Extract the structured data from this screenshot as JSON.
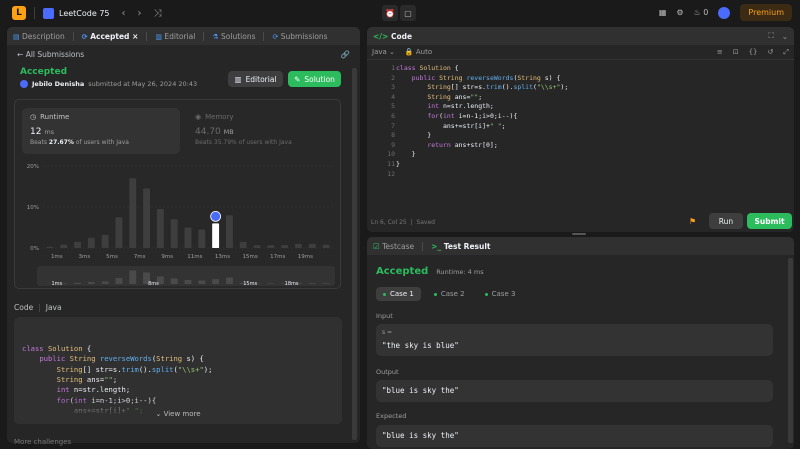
{
  "topbar": {
    "logo": "L",
    "problem_list": "LeetCode 75",
    "streak": "0",
    "premium": "Premium"
  },
  "left_panel": {
    "tabs": [
      {
        "icon": "▤",
        "label": "Description"
      },
      {
        "icon": "⟳",
        "label": "Accepted"
      },
      {
        "icon": "▥",
        "label": "Editorial"
      },
      {
        "icon": "⚗",
        "label": "Solutions"
      },
      {
        "icon": "⟳",
        "label": "Submissions"
      }
    ],
    "close_glyph": "×",
    "back_label": "All Submissions",
    "status": "Accepted",
    "user": "Jebilo Denisha",
    "submitted": "submitted at May 26, 2024 20:43",
    "editorial_btn": "Editorial",
    "solution_btn": "Solution",
    "runtime": {
      "label": "Runtime",
      "value": "12",
      "unit": "ms",
      "beats_prefix": "Beats",
      "beats_pct": "27.67%",
      "beats_suffix": "of users with Java"
    },
    "memory": {
      "label": "Memory",
      "value": "44.70",
      "unit": "MB",
      "beats_text": "Beats 35.79% of users with Java"
    },
    "code_lang_header": "Code",
    "code_lang": "Java",
    "view_more": "View more",
    "more_challenges": "More challenges"
  },
  "chart_data": {
    "type": "bar",
    "ylabel": "",
    "xlabel": "",
    "y_ticks": [
      "20%",
      "10%",
      "0%"
    ],
    "ylim": [
      0,
      20
    ],
    "x_tick_labels": [
      "1ms",
      "3ms",
      "5ms",
      "7ms",
      "9ms",
      "11ms",
      "13ms",
      "15ms",
      "17ms",
      "19ms"
    ],
    "bins_ms": [
      0,
      1,
      2,
      3,
      4,
      5,
      6,
      7,
      8,
      9,
      10,
      11,
      12,
      13,
      14,
      15,
      16,
      17,
      18,
      19,
      20
    ],
    "values": [
      0.3,
      0.8,
      1.5,
      2.5,
      3.2,
      7.5,
      17,
      14.5,
      9.5,
      7,
      5,
      4.5,
      6,
      8,
      1.5,
      0.7,
      0.7,
      0.7,
      1,
      1,
      0.8
    ],
    "highlight_bin_ms": 12,
    "overview_labels": [
      "1ms",
      "8ms",
      "15ms",
      "18ms"
    ]
  },
  "left_code": [
    "class Solution {",
    "    public String reverseWords(String s) {",
    "        String[] str=s.trim().split(\"\\\\s+\");",
    "        String ans=\"\";",
    "        int n=str.length;",
    "        for(int i=n-1;i>0;i--){",
    "            ans+=str[i]+\" \";",
    "        }"
  ],
  "editor": {
    "title": "Code",
    "lang": "Java",
    "mode": "Auto",
    "line_numbers": [
      "1",
      "2",
      "3",
      "4",
      "5",
      "6",
      "7",
      "8",
      "9",
      "10",
      "11",
      "12"
    ],
    "code": [
      "class Solution {",
      "    public String reverseWords(String s) {",
      "        String[] str=s.trim().split(\"\\\\s+\");",
      "        String ans=\"\";",
      "        int n=str.length;",
      "        for(int i=n-1;i>0;i--){",
      "            ans+=str[i]+\" \";",
      "        }",
      "        return ans+str[0];",
      "",
      "    }",
      "}"
    ],
    "status_pos": "Ln 6, Col 25",
    "status_saved": "Saved",
    "run": "Run",
    "submit": "Submit"
  },
  "result": {
    "tab_testcase": "Testcase",
    "tab_result": "Test Result",
    "status": "Accepted",
    "runtime": "Runtime: 4 ms",
    "cases": [
      "Case 1",
      "Case 2",
      "Case 3"
    ],
    "input_label": "Input",
    "input_var": "s =",
    "input_val": "\"the sky is blue\"",
    "output_label": "Output",
    "output_val": "\"blue is sky the\"",
    "expected_label": "Expected",
    "expected_val": "\"blue is sky the\""
  },
  "colors": {
    "accent_green": "#2cbb5d",
    "brand_orange": "#ffa116",
    "highlight_bar": "#ffffff",
    "bar": "#3e3e3e"
  }
}
